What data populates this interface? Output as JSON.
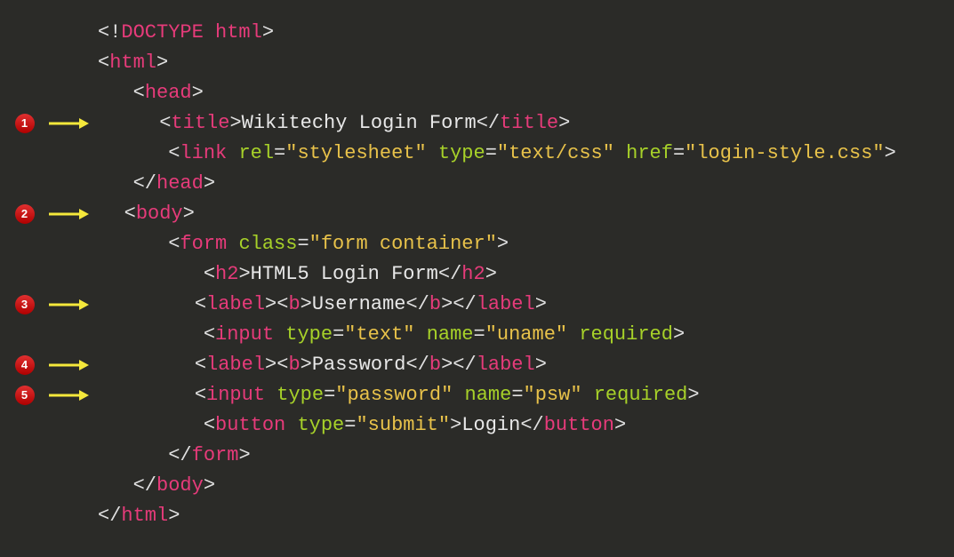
{
  "annotations": [
    {
      "num": "1",
      "row": 3
    },
    {
      "num": "2",
      "row": 6
    },
    {
      "num": "3",
      "row": 9
    },
    {
      "num": "4",
      "row": 11
    },
    {
      "num": "5",
      "row": 12
    }
  ],
  "code": [
    {
      "indent": 0,
      "tokens": [
        {
          "t": "<!",
          "c": "punct"
        },
        {
          "t": "DOCTYPE html",
          "c": "tag"
        },
        {
          "t": ">",
          "c": "punct"
        }
      ]
    },
    {
      "indent": 0,
      "tokens": [
        {
          "t": "<",
          "c": "punct"
        },
        {
          "t": "html",
          "c": "tag"
        },
        {
          "t": ">",
          "c": "punct"
        }
      ]
    },
    {
      "indent": 1,
      "tokens": [
        {
          "t": "<",
          "c": "punct"
        },
        {
          "t": "head",
          "c": "tag"
        },
        {
          "t": ">",
          "c": "punct"
        }
      ]
    },
    {
      "indent": 2,
      "tokens": [
        {
          "t": "<",
          "c": "punct"
        },
        {
          "t": "title",
          "c": "tag"
        },
        {
          "t": ">",
          "c": "punct"
        },
        {
          "t": "Wikitechy Login Form",
          "c": "text"
        },
        {
          "t": "</",
          "c": "punct"
        },
        {
          "t": "title",
          "c": "tag"
        },
        {
          "t": ">",
          "c": "punct"
        }
      ]
    },
    {
      "indent": 2,
      "tokens": [
        {
          "t": "<",
          "c": "punct"
        },
        {
          "t": "link",
          "c": "tag"
        },
        {
          "t": " ",
          "c": "punct"
        },
        {
          "t": "rel",
          "c": "attr"
        },
        {
          "t": "=",
          "c": "punct"
        },
        {
          "t": "\"stylesheet\"",
          "c": "str"
        },
        {
          "t": " ",
          "c": "punct"
        },
        {
          "t": "type",
          "c": "attr"
        },
        {
          "t": "=",
          "c": "punct"
        },
        {
          "t": "\"text/css\"",
          "c": "str"
        },
        {
          "t": " ",
          "c": "punct"
        },
        {
          "t": "href",
          "c": "attr"
        },
        {
          "t": "=",
          "c": "punct"
        },
        {
          "t": "\"login-style.css\"",
          "c": "str"
        },
        {
          "t": ">",
          "c": "punct"
        }
      ]
    },
    {
      "indent": 1,
      "tokens": [
        {
          "t": "</",
          "c": "punct"
        },
        {
          "t": "head",
          "c": "tag"
        },
        {
          "t": ">",
          "c": "punct"
        }
      ]
    },
    {
      "indent": 1,
      "tokens": [
        {
          "t": "<",
          "c": "punct"
        },
        {
          "t": "body",
          "c": "tag"
        },
        {
          "t": ">",
          "c": "punct"
        }
      ]
    },
    {
      "indent": 2,
      "tokens": [
        {
          "t": "<",
          "c": "punct"
        },
        {
          "t": "form",
          "c": "tag"
        },
        {
          "t": " ",
          "c": "punct"
        },
        {
          "t": "class",
          "c": "attr"
        },
        {
          "t": "=",
          "c": "punct"
        },
        {
          "t": "\"form container\"",
          "c": "str"
        },
        {
          "t": ">",
          "c": "punct"
        }
      ]
    },
    {
      "indent": 3,
      "tokens": [
        {
          "t": "<",
          "c": "punct"
        },
        {
          "t": "h2",
          "c": "tag"
        },
        {
          "t": ">",
          "c": "punct"
        },
        {
          "t": "HTML5 Login Form",
          "c": "text"
        },
        {
          "t": "</",
          "c": "punct"
        },
        {
          "t": "h2",
          "c": "tag"
        },
        {
          "t": ">",
          "c": "punct"
        }
      ]
    },
    {
      "indent": 3,
      "tokens": [
        {
          "t": "<",
          "c": "punct"
        },
        {
          "t": "label",
          "c": "tag"
        },
        {
          "t": ">",
          "c": "punct"
        },
        {
          "t": "<",
          "c": "punct"
        },
        {
          "t": "b",
          "c": "tag"
        },
        {
          "t": ">",
          "c": "punct"
        },
        {
          "t": "Username",
          "c": "text"
        },
        {
          "t": "</",
          "c": "punct"
        },
        {
          "t": "b",
          "c": "tag"
        },
        {
          "t": ">",
          "c": "punct"
        },
        {
          "t": "</",
          "c": "punct"
        },
        {
          "t": "label",
          "c": "tag"
        },
        {
          "t": ">",
          "c": "punct"
        }
      ]
    },
    {
      "indent": 3,
      "tokens": [
        {
          "t": "<",
          "c": "punct"
        },
        {
          "t": "input",
          "c": "tag"
        },
        {
          "t": " ",
          "c": "punct"
        },
        {
          "t": "type",
          "c": "attr"
        },
        {
          "t": "=",
          "c": "punct"
        },
        {
          "t": "\"text\"",
          "c": "str"
        },
        {
          "t": " ",
          "c": "punct"
        },
        {
          "t": "name",
          "c": "attr"
        },
        {
          "t": "=",
          "c": "punct"
        },
        {
          "t": "\"uname\"",
          "c": "str"
        },
        {
          "t": " ",
          "c": "punct"
        },
        {
          "t": "required",
          "c": "attr"
        },
        {
          "t": ">",
          "c": "punct"
        }
      ]
    },
    {
      "indent": 3,
      "tokens": [
        {
          "t": "<",
          "c": "punct"
        },
        {
          "t": "label",
          "c": "tag"
        },
        {
          "t": ">",
          "c": "punct"
        },
        {
          "t": "<",
          "c": "punct"
        },
        {
          "t": "b",
          "c": "tag"
        },
        {
          "t": ">",
          "c": "punct"
        },
        {
          "t": "Password",
          "c": "text"
        },
        {
          "t": "</",
          "c": "punct"
        },
        {
          "t": "b",
          "c": "tag"
        },
        {
          "t": ">",
          "c": "punct"
        },
        {
          "t": "</",
          "c": "punct"
        },
        {
          "t": "label",
          "c": "tag"
        },
        {
          "t": ">",
          "c": "punct"
        }
      ]
    },
    {
      "indent": 3,
      "tokens": [
        {
          "t": "<",
          "c": "punct"
        },
        {
          "t": "input",
          "c": "tag"
        },
        {
          "t": " ",
          "c": "punct"
        },
        {
          "t": "type",
          "c": "attr"
        },
        {
          "t": "=",
          "c": "punct"
        },
        {
          "t": "\"password\"",
          "c": "str"
        },
        {
          "t": " ",
          "c": "punct"
        },
        {
          "t": "name",
          "c": "attr"
        },
        {
          "t": "=",
          "c": "punct"
        },
        {
          "t": "\"psw\"",
          "c": "str"
        },
        {
          "t": " ",
          "c": "punct"
        },
        {
          "t": "required",
          "c": "attr"
        },
        {
          "t": ">",
          "c": "punct"
        }
      ]
    },
    {
      "indent": 3,
      "tokens": [
        {
          "t": "<",
          "c": "punct"
        },
        {
          "t": "button",
          "c": "tag"
        },
        {
          "t": " ",
          "c": "punct"
        },
        {
          "t": "type",
          "c": "attr"
        },
        {
          "t": "=",
          "c": "punct"
        },
        {
          "t": "\"submit\"",
          "c": "str"
        },
        {
          "t": ">",
          "c": "punct"
        },
        {
          "t": "Login",
          "c": "text"
        },
        {
          "t": "</",
          "c": "punct"
        },
        {
          "t": "button",
          "c": "tag"
        },
        {
          "t": ">",
          "c": "punct"
        }
      ]
    },
    {
      "indent": 2,
      "tokens": [
        {
          "t": "</",
          "c": "punct"
        },
        {
          "t": "form",
          "c": "tag"
        },
        {
          "t": ">",
          "c": "punct"
        }
      ]
    },
    {
      "indent": 1,
      "tokens": [
        {
          "t": "</",
          "c": "punct"
        },
        {
          "t": "body",
          "c": "tag"
        },
        {
          "t": ">",
          "c": "punct"
        }
      ]
    },
    {
      "indent": 0,
      "tokens": [
        {
          "t": "</",
          "c": "punct"
        },
        {
          "t": "html",
          "c": "tag"
        },
        {
          "t": ">",
          "c": "punct"
        }
      ]
    }
  ]
}
